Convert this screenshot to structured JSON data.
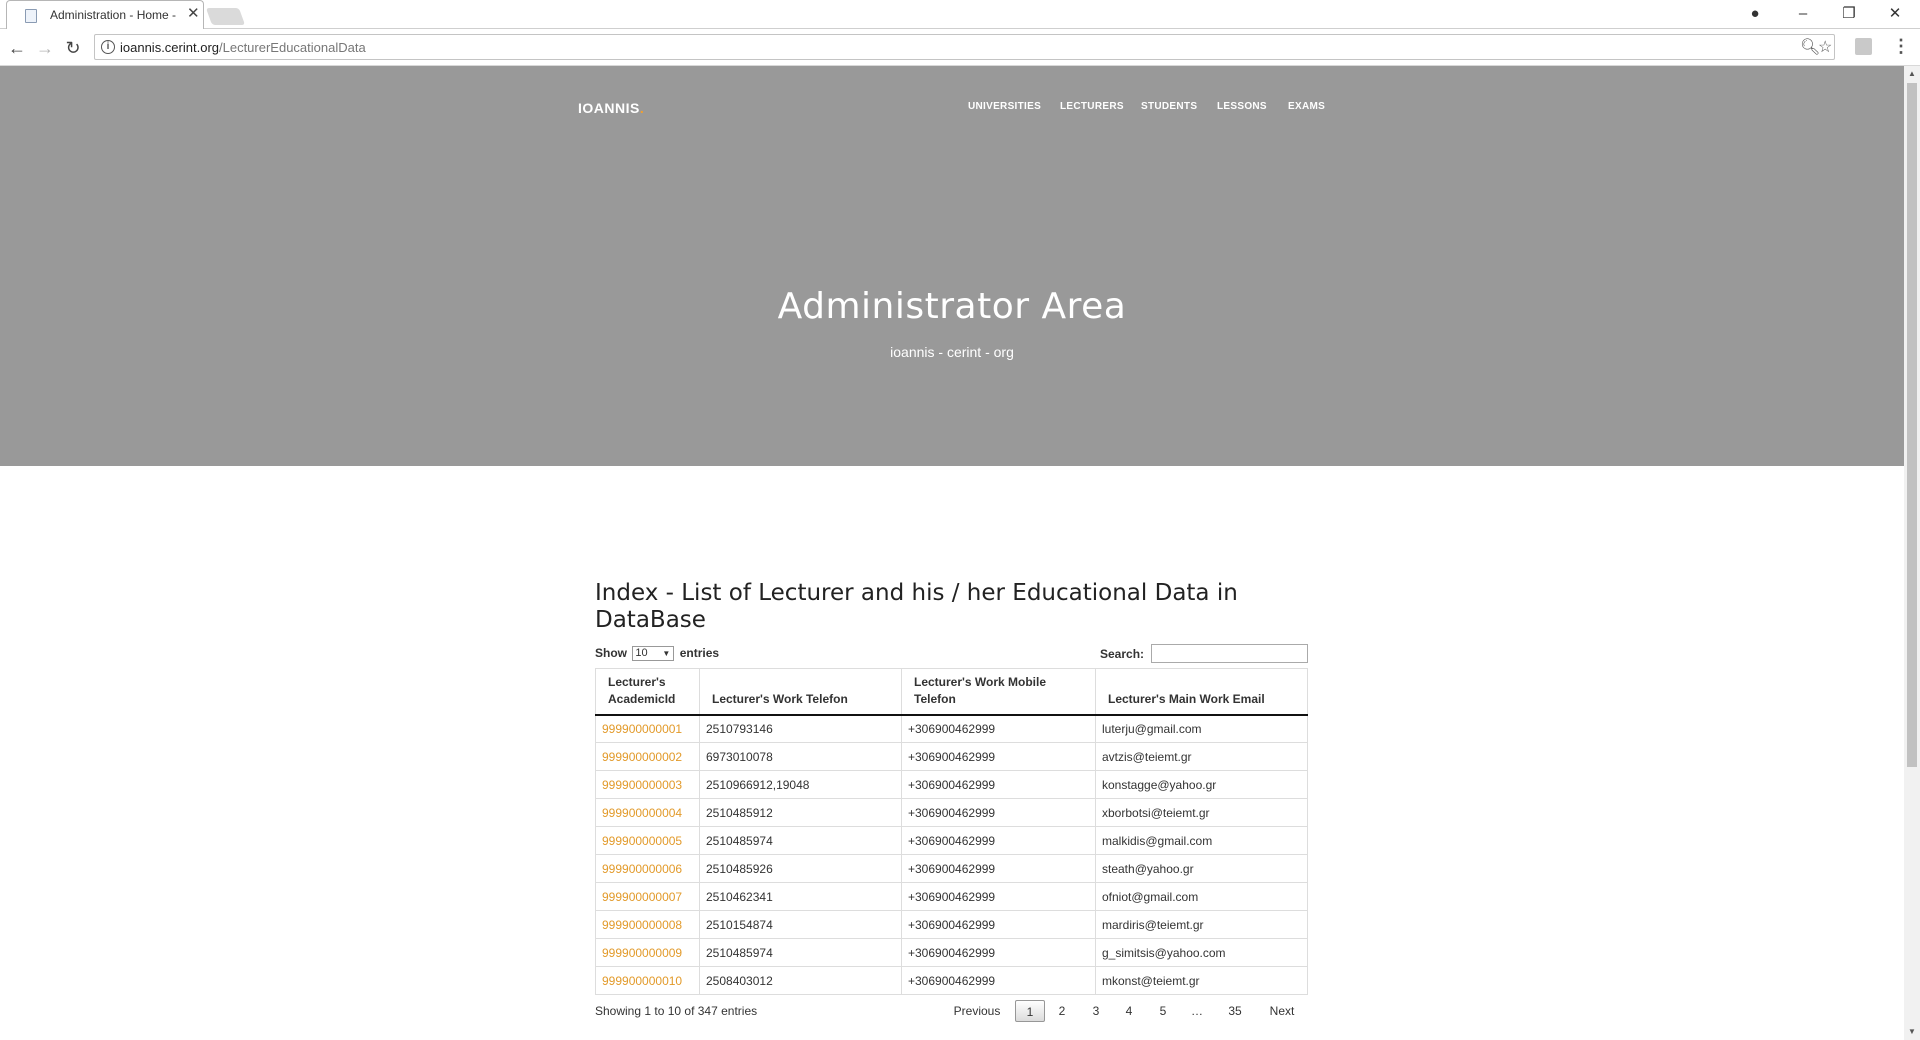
{
  "browser": {
    "tab_title": "Administration - Home -",
    "tab_close": "✕",
    "url_host": "ioannis.cerint.org",
    "url_path": "/LecturerEducationalData"
  },
  "site": {
    "brand": "IOANNIS",
    "brand_dot": ".",
    "nav": [
      "UNIVERSITIES",
      "LECTURERS",
      "STUDENTS",
      "LESSONS",
      "EXAMS"
    ],
    "hero_title": "Administrator Area",
    "hero_subtitle": "ioannis - cerint - org"
  },
  "page": {
    "heading": "Index - List of Lecturer and his / her Educational Data in DataBase",
    "show_label": "Show",
    "length_value": "10",
    "entries_label": "entries",
    "search_label": "Search:",
    "search_value": ""
  },
  "table": {
    "headers": [
      "Lecturer's AcademicId",
      "Lecturer's Work Telefon",
      "Lecturer's Work Mobile Telefon",
      "Lecturer's Main Work Email"
    ],
    "rows": [
      [
        "999900000001",
        "2510793146",
        "+306900462999",
        "luterju@gmail.com"
      ],
      [
        "999900000002",
        "6973010078",
        "+306900462999",
        "avtzis@teiemt.gr"
      ],
      [
        "999900000003",
        "2510966912,19048",
        "+306900462999",
        "konstagge@yahoo.gr"
      ],
      [
        "999900000004",
        "2510485912",
        "+306900462999",
        "xborbotsi@teiemt.gr"
      ],
      [
        "999900000005",
        "2510485974",
        "+306900462999",
        "malkidis@gmail.com"
      ],
      [
        "999900000006",
        "2510485926",
        "+306900462999",
        "steath@yahoo.gr"
      ],
      [
        "999900000007",
        "2510462341",
        "+306900462999",
        "ofniot@gmail.com"
      ],
      [
        "999900000008",
        "2510154874",
        "+306900462999",
        "mardiris@teiemt.gr"
      ],
      [
        "999900000009",
        "2510485974",
        "+306900462999",
        "g_simitsis@yahoo.com"
      ],
      [
        "999900000010",
        "2508403012",
        "+306900462999",
        "mkonst@teiemt.gr"
      ]
    ]
  },
  "footer": {
    "info": "Showing 1 to 10 of 347 entries",
    "previous": "Previous",
    "pages": [
      "1",
      "2",
      "3",
      "4",
      "5",
      "…",
      "35"
    ],
    "next": "Next"
  },
  "colors": {
    "hero_bg": "#999999",
    "link": "#e29a2a"
  }
}
